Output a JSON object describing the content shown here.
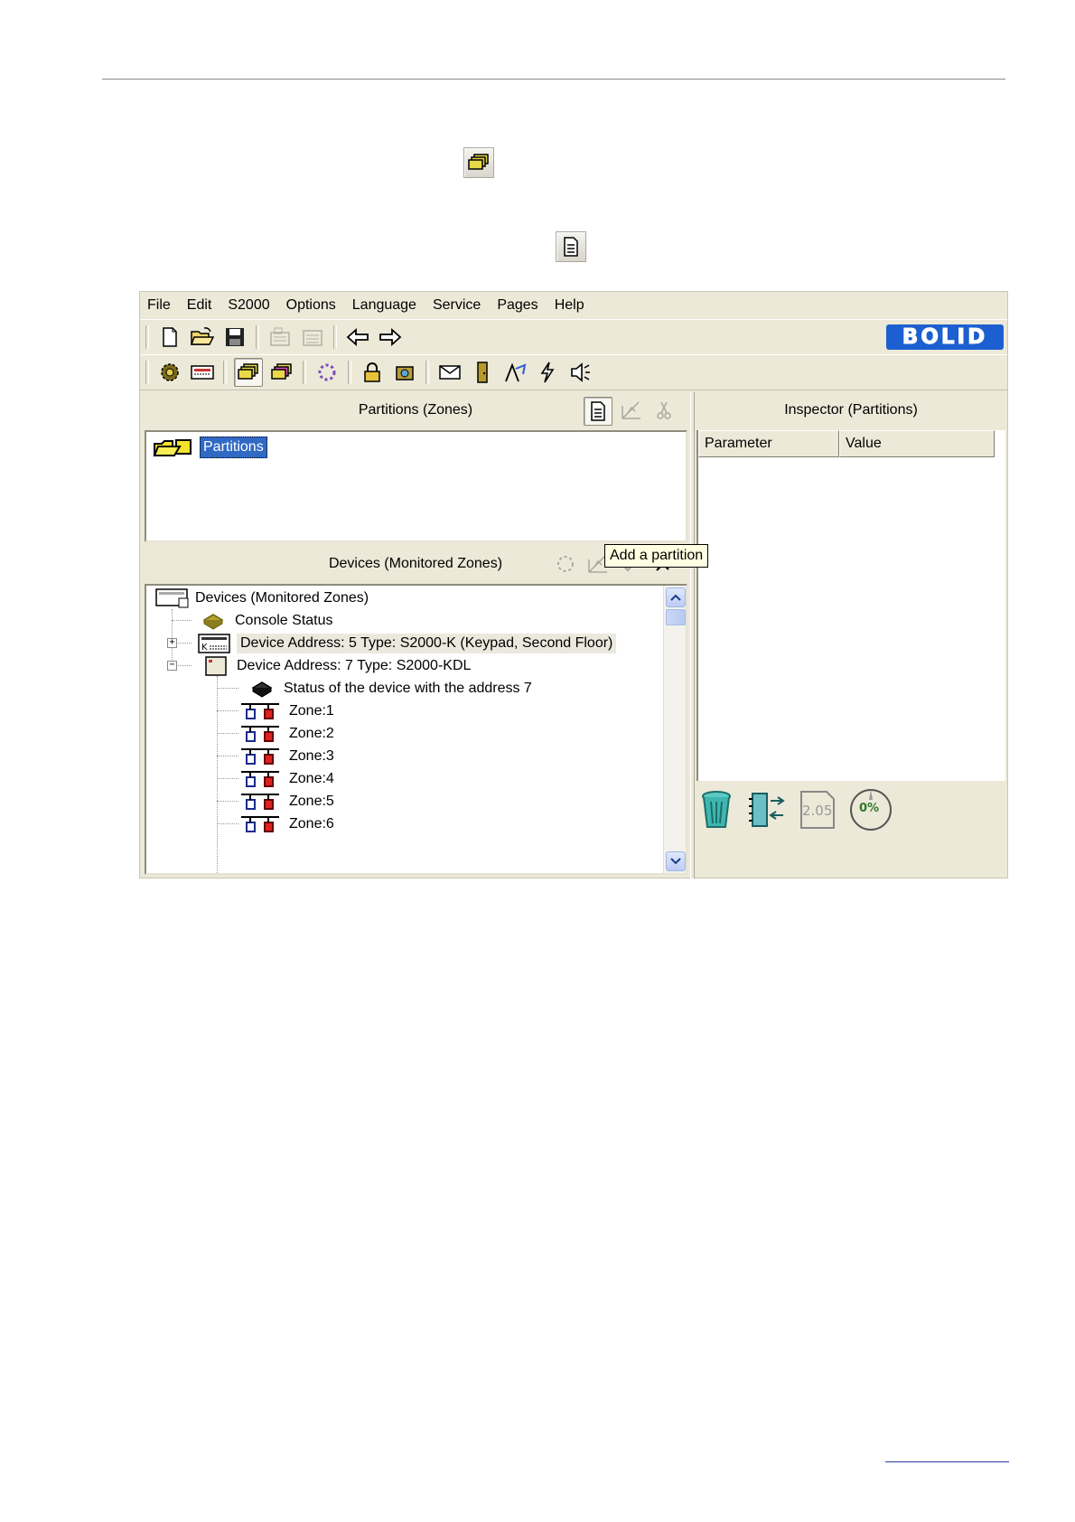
{
  "menu": [
    "File",
    "Edit",
    "S2000",
    "Options",
    "Language",
    "Service",
    "Pages",
    "Help"
  ],
  "logo_text": "BOLID",
  "partitions_panel": {
    "title": "Partitions (Zones)",
    "root_label": "Partitions",
    "tooltip": "Add a partition"
  },
  "devices_panel": {
    "title": "Devices (Monitored Zones)",
    "tree": {
      "root": "Devices (Monitored Zones)",
      "console_status": "Console Status",
      "device5": "Device Address: 5 Type: S2000-K (Keypad, Second Floor)",
      "device7": "Device Address: 7 Type: S2000-KDL",
      "device7_status": "Status of the device with the address 7",
      "zones": [
        "Zone:1",
        "Zone:2",
        "Zone:3",
        "Zone:4",
        "Zone:5",
        "Zone:6"
      ]
    }
  },
  "inspector_panel": {
    "title": "Inspector (Partitions)",
    "columns": [
      "Parameter",
      "Value"
    ]
  },
  "status_icons": {
    "version": "2.05",
    "progress_percent": "0%"
  },
  "colors": {
    "window_bg": "#ece9d8",
    "selection": "#316ac5",
    "logo_bg": "#1c5fd0",
    "tooltip_bg": "#ffffe1"
  }
}
